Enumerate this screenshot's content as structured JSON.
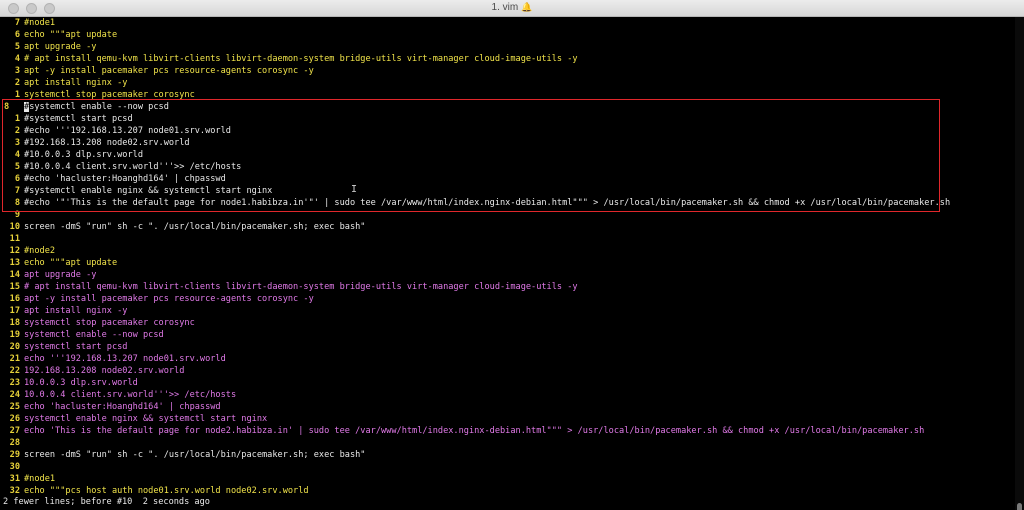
{
  "window": {
    "title": "1. vim",
    "bell_icon": "bell-icon"
  },
  "lines": [
    {
      "num": "7",
      "parts": [
        {
          "t": "#node1",
          "c": "yellow"
        }
      ]
    },
    {
      "num": "6",
      "parts": [
        {
          "t": "echo \"\"\"apt update",
          "c": "yellow"
        }
      ]
    },
    {
      "num": "5",
      "parts": [
        {
          "t": "apt upgrade -y",
          "c": "yellow"
        }
      ]
    },
    {
      "num": "4",
      "parts": [
        {
          "t": "# apt install qemu-kvm libvirt-clients libvirt-daemon-system bridge-utils virt-manager cloud-image-utils -y",
          "c": "yellow"
        }
      ]
    },
    {
      "num": "3",
      "parts": [
        {
          "t": "apt -y install pacemaker pcs resource-agents corosync -y",
          "c": "yellow"
        }
      ]
    },
    {
      "num": "2",
      "parts": [
        {
          "t": "apt install nginx -y",
          "c": "yellow"
        }
      ]
    },
    {
      "num": "1",
      "parts": [
        {
          "t": "systemctl stop pacemaker corosync",
          "c": "yellow"
        }
      ]
    },
    {
      "num": "8",
      "current": true,
      "parts": [
        {
          "t": "#",
          "c": "cursor"
        },
        {
          "t": "systemctl enable --now pcsd",
          "c": "white"
        }
      ]
    },
    {
      "num": "1",
      "parts": [
        {
          "t": "#systemctl start pcsd",
          "c": "white"
        }
      ]
    },
    {
      "num": "2",
      "parts": [
        {
          "t": "#echo '''192.168.13.207 node01.srv.world",
          "c": "white"
        }
      ]
    },
    {
      "num": "3",
      "parts": [
        {
          "t": "#192.168.13.208 node02.srv.world",
          "c": "white"
        }
      ]
    },
    {
      "num": "4",
      "parts": [
        {
          "t": "#10.0.0.3 dlp.srv.world",
          "c": "white"
        }
      ]
    },
    {
      "num": "5",
      "parts": [
        {
          "t": "#10.0.0.4 client.srv.world'''>> /etc/hosts",
          "c": "white"
        }
      ]
    },
    {
      "num": "6",
      "parts": [
        {
          "t": "#echo 'hacluster:Hoanghd164' | chpasswd",
          "c": "white"
        }
      ]
    },
    {
      "num": "7",
      "parts": [
        {
          "t": "#systemctl enable nginx && systemctl start nginx",
          "c": "white"
        }
      ]
    },
    {
      "num": "8",
      "parts": [
        {
          "t": "#echo '\"'This is the default page for node1.habibza.in'\"' | sudo tee /var/www/html/index.nginx-debian.html\"\"\" > /usr/local/bin/pacemaker.sh && chmod +x /usr/local/bin/pacemaker.sh",
          "c": "white"
        }
      ]
    },
    {
      "num": "9",
      "parts": [
        {
          "t": "",
          "c": "white"
        }
      ]
    },
    {
      "num": "10",
      "parts": [
        {
          "t": "screen -dmS \"run\" sh -c \". /usr/local/bin/pacemaker.sh; exec bash\"",
          "c": "white"
        }
      ]
    },
    {
      "num": "11",
      "parts": [
        {
          "t": "",
          "c": "white"
        }
      ]
    },
    {
      "num": "12",
      "parts": [
        {
          "t": "#node2",
          "c": "yellow"
        }
      ]
    },
    {
      "num": "13",
      "parts": [
        {
          "t": "echo \"\"\"apt update",
          "c": "yellow"
        }
      ]
    },
    {
      "num": "14",
      "parts": [
        {
          "t": "apt upgrade -y",
          "c": "magenta"
        }
      ]
    },
    {
      "num": "15",
      "parts": [
        {
          "t": "# apt install qemu-kvm libvirt-clients libvirt-daemon-system bridge-utils virt-manager cloud-image-utils -y",
          "c": "magenta"
        }
      ]
    },
    {
      "num": "16",
      "parts": [
        {
          "t": "apt -y install pacemaker pcs resource-agents corosync -y",
          "c": "magenta"
        }
      ]
    },
    {
      "num": "17",
      "parts": [
        {
          "t": "apt install nginx -y",
          "c": "magenta"
        }
      ]
    },
    {
      "num": "18",
      "parts": [
        {
          "t": "systemctl stop pacemaker corosync",
          "c": "magenta"
        }
      ]
    },
    {
      "num": "19",
      "parts": [
        {
          "t": "systemctl enable --now pcsd",
          "c": "magenta"
        }
      ]
    },
    {
      "num": "20",
      "parts": [
        {
          "t": "systemctl start pcsd",
          "c": "magenta"
        }
      ]
    },
    {
      "num": "21",
      "parts": [
        {
          "t": "echo '''192.168.13.207 node01.srv.world",
          "c": "magenta"
        }
      ]
    },
    {
      "num": "22",
      "parts": [
        {
          "t": "192.168.13.208 node02.srv.world",
          "c": "magenta"
        }
      ]
    },
    {
      "num": "23",
      "parts": [
        {
          "t": "10.0.0.3 dlp.srv.world",
          "c": "magenta"
        }
      ]
    },
    {
      "num": "24",
      "parts": [
        {
          "t": "10.0.0.4 client.srv.world'''>> /etc/hosts",
          "c": "magenta"
        }
      ]
    },
    {
      "num": "25",
      "parts": [
        {
          "t": "echo 'hacluster:Hoanghd164' | chpasswd",
          "c": "magenta"
        }
      ]
    },
    {
      "num": "26",
      "parts": [
        {
          "t": "systemctl enable nginx && systemctl start nginx",
          "c": "magenta"
        }
      ]
    },
    {
      "num": "27",
      "parts": [
        {
          "t": "echo 'This is the default page for node2.habibza.in' | sudo tee /var/www/html/index.nginx-debian.html\"\"\" > /usr/local/bin/pacemaker.sh && chmod +x /usr/local/bin/pacemaker.sh",
          "c": "magenta"
        }
      ]
    },
    {
      "num": "28",
      "parts": [
        {
          "t": "",
          "c": "white"
        }
      ]
    },
    {
      "num": "29",
      "parts": [
        {
          "t": "screen -dmS \"run\" sh -c \". /usr/local/bin/pacemaker.sh; exec bash\"",
          "c": "white"
        }
      ]
    },
    {
      "num": "30",
      "parts": [
        {
          "t": "",
          "c": "white"
        }
      ]
    },
    {
      "num": "31",
      "parts": [
        {
          "t": "#node1",
          "c": "yellow"
        }
      ]
    },
    {
      "num": "32",
      "parts": [
        {
          "t": "echo \"\"\"pcs host auth node01.srv.world node02.srv.world",
          "c": "yellow"
        }
      ]
    }
  ],
  "status": {
    "text": "2 fewer lines; before #10  2 seconds ago"
  }
}
